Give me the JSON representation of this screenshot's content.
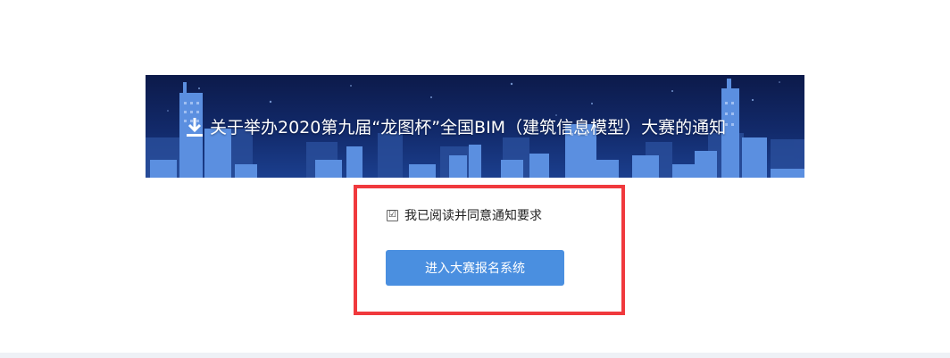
{
  "banner": {
    "title": "关于举办2020第九届“龙图杯”全国BIM（建筑信息模型）大赛的通知",
    "icon": "download-icon"
  },
  "agreement": {
    "label": "我已阅读并同意通知要求",
    "checked": true,
    "check_glyph": "☑"
  },
  "enter_button": {
    "label": "进入大赛报名系统"
  },
  "colors": {
    "highlight_border": "#f0393d",
    "button_bg": "#4a8fe0",
    "banner_dark": "#0c1a4a"
  }
}
